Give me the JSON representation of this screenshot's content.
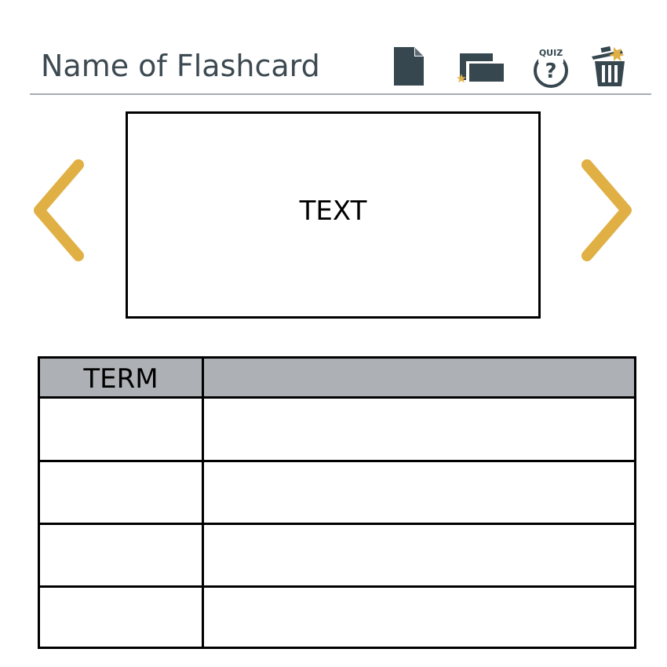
{
  "header": {
    "title": "Name of Flashcard",
    "icons": {
      "new_card": "document-icon",
      "flashcards": "cards-star-icon",
      "quiz": "quiz-icon",
      "quiz_label": "QUIZ",
      "delete": "trash-icon"
    }
  },
  "card": {
    "text": "TEXT"
  },
  "nav": {
    "prev": "chevron-left-icon",
    "next": "chevron-right-icon"
  },
  "table": {
    "headers": [
      "TERM",
      ""
    ],
    "rows": [
      {
        "term": "",
        "definition": ""
      },
      {
        "term": "",
        "definition": ""
      },
      {
        "term": "",
        "definition": ""
      },
      {
        "term": "",
        "definition": ""
      }
    ]
  },
  "colors": {
    "accent": "#e0b044",
    "icon": "#37474f",
    "header_fill": "#adb1b5",
    "title_text": "#3d4a52",
    "rule": "#a7acb0"
  }
}
